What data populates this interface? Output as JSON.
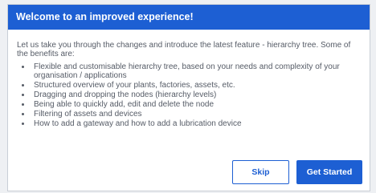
{
  "dialog": {
    "title": "Welcome to an improved experience!",
    "intro": "Let us take you through the changes and introduce the latest feature - hierarchy tree. Some of the benefits are:",
    "benefits": [
      "Flexible and customisable hierarchy tree, based on your needs and complexity of your organisation / applications",
      "Structured overview of your plants, factories, assets, etc.",
      "Dragging and dropping the nodes (hierarchy levels)",
      "Being able to quickly add, edit and delete the node",
      "Filtering of assets and devices",
      "How to add a gateway and how to add a lubrication device"
    ],
    "skip_label": "Skip",
    "start_label": "Get Started"
  },
  "colors": {
    "accent": "#1d5fd3",
    "text": "#555b66",
    "border": "#c9ced6"
  }
}
